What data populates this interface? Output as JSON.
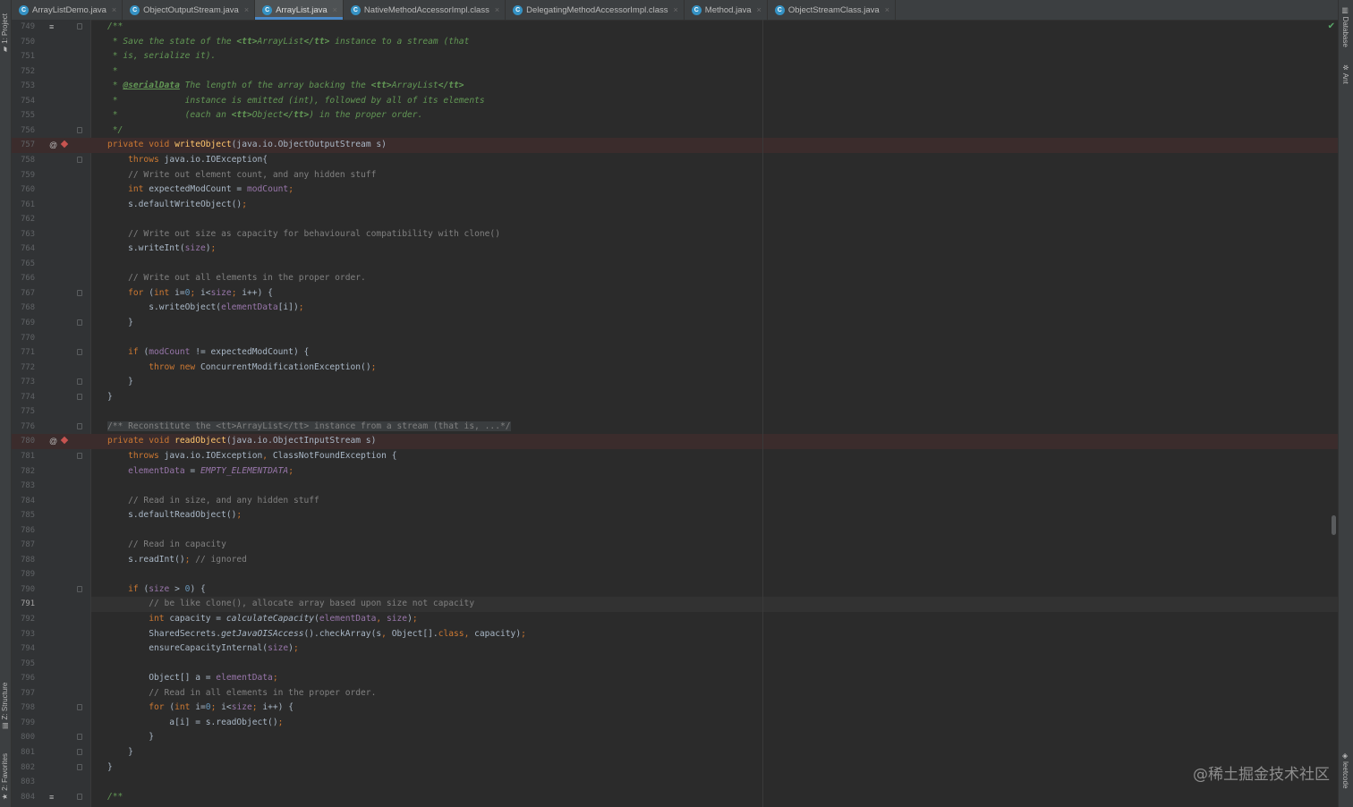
{
  "side_left": {
    "project": "1: Project",
    "structure": "Z: Structure",
    "favorites": "2: Favorites"
  },
  "side_right": {
    "database": "Database",
    "ant": "Ant",
    "leetcode": "leetcode"
  },
  "tabs": [
    {
      "label": "ArrayListDemo.java",
      "icon": "C",
      "active": false
    },
    {
      "label": "ObjectOutputStream.java",
      "icon": "C",
      "active": false
    },
    {
      "label": "ArrayList.java",
      "icon": "C",
      "active": true
    },
    {
      "label": "NativeMethodAccessorImpl.class",
      "icon": "C",
      "active": false
    },
    {
      "label": "DelegatingMethodAccessorImpl.class",
      "icon": "C",
      "active": false
    },
    {
      "label": "Method.java",
      "icon": "C",
      "active": false
    },
    {
      "label": "ObjectStreamClass.java",
      "icon": "C",
      "active": false
    }
  ],
  "close_glyph": "×",
  "watermark": "@稀土掘金技术社区",
  "caret_line": 791,
  "lines": [
    {
      "n": "749",
      "marker": "≡",
      "fold": true,
      "html": "<span class=\"d\">/**</span>"
    },
    {
      "n": "750",
      "html": "<span class=\"d\"> * Save the state of the </span><span class=\"tg\">&lt;tt&gt;</span><span class=\"d\">ArrayList</span><span class=\"tg\">&lt;/tt&gt;</span><span class=\"d\"> instance to a stream (that</span>"
    },
    {
      "n": "751",
      "html": "<span class=\"d\"> * is, serialize it).</span>"
    },
    {
      "n": "752",
      "html": "<span class=\"d\"> *</span>"
    },
    {
      "n": "753",
      "html": "<span class=\"d\"> * </span><span class=\"dt\">@serialData</span><span class=\"d\"> The length of the array backing the </span><span class=\"tg\">&lt;tt&gt;</span><span class=\"d\">ArrayList</span><span class=\"tg\">&lt;/tt&gt;</span>"
    },
    {
      "n": "754",
      "html": "<span class=\"d\"> *             instance is emitted (int), followed by all of its elements</span>"
    },
    {
      "n": "755",
      "html": "<span class=\"d\"> *             (each an </span><span class=\"tg\">&lt;tt&gt;</span><span class=\"d\">Object</span><span class=\"tg\">&lt;/tt&gt;</span><span class=\"d\">) in the proper order.</span>"
    },
    {
      "n": "756",
      "fold": true,
      "html": "<span class=\"d\"> */</span>"
    },
    {
      "n": "757",
      "marker": "@",
      "bp": true,
      "html": "<span class=\"k\">private void </span><span class=\"m\">writeObject</span>(java.io.ObjectOutputStream s)"
    },
    {
      "n": "758",
      "fold": true,
      "html": "    <span class=\"k\">throws </span>java.io.IOException{"
    },
    {
      "n": "759",
      "html": "    <span class=\"c\">// Write out element count, and any hidden stuff</span>"
    },
    {
      "n": "760",
      "html": "    <span class=\"k\">int </span>expectedModCount = <span class=\"f\">modCount</span><span class=\"k\">;</span>"
    },
    {
      "n": "761",
      "html": "    s.defaultWriteObject()<span class=\"k\">;</span>"
    },
    {
      "n": "762",
      "html": ""
    },
    {
      "n": "763",
      "html": "    <span class=\"c\">// Write out size as capacity for behavioural compatibility with clone()</span>"
    },
    {
      "n": "764",
      "html": "    s.writeInt(<span class=\"f\">size</span>)<span class=\"k\">;</span>"
    },
    {
      "n": "765",
      "html": ""
    },
    {
      "n": "766",
      "html": "    <span class=\"c\">// Write out all elements in the proper order.</span>"
    },
    {
      "n": "767",
      "fold": true,
      "html": "    <span class=\"k\">for </span>(<span class=\"k\">int </span>i=<span class=\"n\">0</span><span class=\"k\">; </span>i&lt;<span class=\"f\">size</span><span class=\"k\">; </span>i++) {"
    },
    {
      "n": "768",
      "html": "        s.writeObject(<span class=\"f\">elementData</span>[i])<span class=\"k\">;</span>"
    },
    {
      "n": "769",
      "fold": true,
      "html": "    }"
    },
    {
      "n": "770",
      "html": ""
    },
    {
      "n": "771",
      "fold": true,
      "html": "    <span class=\"k\">if </span>(<span class=\"f\">modCount </span>!= expectedModCount) {"
    },
    {
      "n": "772",
      "html": "        <span class=\"k\">throw new </span>ConcurrentModificationException()<span class=\"k\">;</span>"
    },
    {
      "n": "773",
      "fold": true,
      "html": "    }"
    },
    {
      "n": "774",
      "fold": true,
      "html": "}"
    },
    {
      "n": "775",
      "html": ""
    },
    {
      "n": "776",
      "fold": true,
      "html": "<span class=\"fold-txt\">/** Reconstitute the &lt;tt&gt;ArrayList&lt;/tt&gt; instance from a stream (that is, ...*/</span>"
    },
    {
      "n": "780",
      "marker": "@",
      "bp": true,
      "html": "<span class=\"k\">private void </span><span class=\"m\">readObject</span>(java.io.ObjectInputStream s)"
    },
    {
      "n": "781",
      "fold": true,
      "html": "    <span class=\"k\">throws </span>java.io.IOException<span class=\"k\">, </span>ClassNotFoundException {"
    },
    {
      "n": "782",
      "html": "    <span class=\"f\">elementData </span>= <span class=\"fi\">EMPTY_ELEMENTDATA</span><span class=\"k\">;</span>"
    },
    {
      "n": "783",
      "html": ""
    },
    {
      "n": "784",
      "html": "    <span class=\"c\">// Read in size, and any hidden stuff</span>"
    },
    {
      "n": "785",
      "html": "    s.defaultReadObject()<span class=\"k\">;</span>"
    },
    {
      "n": "786",
      "html": ""
    },
    {
      "n": "787",
      "html": "    <span class=\"c\">// Read in capacity</span>"
    },
    {
      "n": "788",
      "html": "    s.readInt()<span class=\"k\">; </span><span class=\"c\">// ignored</span>"
    },
    {
      "n": "789",
      "html": ""
    },
    {
      "n": "790",
      "fold": true,
      "html": "    <span class=\"k\">if </span>(<span class=\"f\">size </span>&gt; <span class=\"n\">0</span>) {"
    },
    {
      "n": "791",
      "html": "        <span class=\"c\">// be like clone(), allocate array based upon size not capacity</span>"
    },
    {
      "n": "792",
      "html": "        <span class=\"k\">int </span>capacity = <span class=\"si\">calculateCapacity</span>(<span class=\"f\">elementData</span><span class=\"k\">, </span><span class=\"f\">size</span>)<span class=\"k\">;</span>"
    },
    {
      "n": "793",
      "html": "        SharedSecrets.<span class=\"si\">getJavaOISAccess</span>().checkArray(s<span class=\"k\">, </span>Object[].<span class=\"k\">class, </span>capacity)<span class=\"k\">;</span>"
    },
    {
      "n": "794",
      "html": "        ensureCapacityInternal(<span class=\"f\">size</span>)<span class=\"k\">;</span>"
    },
    {
      "n": "795",
      "html": ""
    },
    {
      "n": "796",
      "html": "        Object[] a = <span class=\"f\">elementData</span><span class=\"k\">;</span>"
    },
    {
      "n": "797",
      "html": "        <span class=\"c\">// Read in all elements in the proper order.</span>"
    },
    {
      "n": "798",
      "fold": true,
      "html": "        <span class=\"k\">for </span>(<span class=\"k\">int </span>i=<span class=\"n\">0</span><span class=\"k\">; </span>i&lt;<span class=\"f\">size</span><span class=\"k\">; </span>i++) {"
    },
    {
      "n": "799",
      "html": "            a[i] = s.readObject()<span class=\"k\">;</span>"
    },
    {
      "n": "800",
      "fold": true,
      "html": "        }"
    },
    {
      "n": "801",
      "fold": true,
      "html": "    }"
    },
    {
      "n": "802",
      "fold": true,
      "html": "}"
    },
    {
      "n": "803",
      "html": ""
    },
    {
      "n": "804",
      "marker": "≡",
      "fold": true,
      "html": "<span class=\"d\">/**</span>"
    }
  ]
}
